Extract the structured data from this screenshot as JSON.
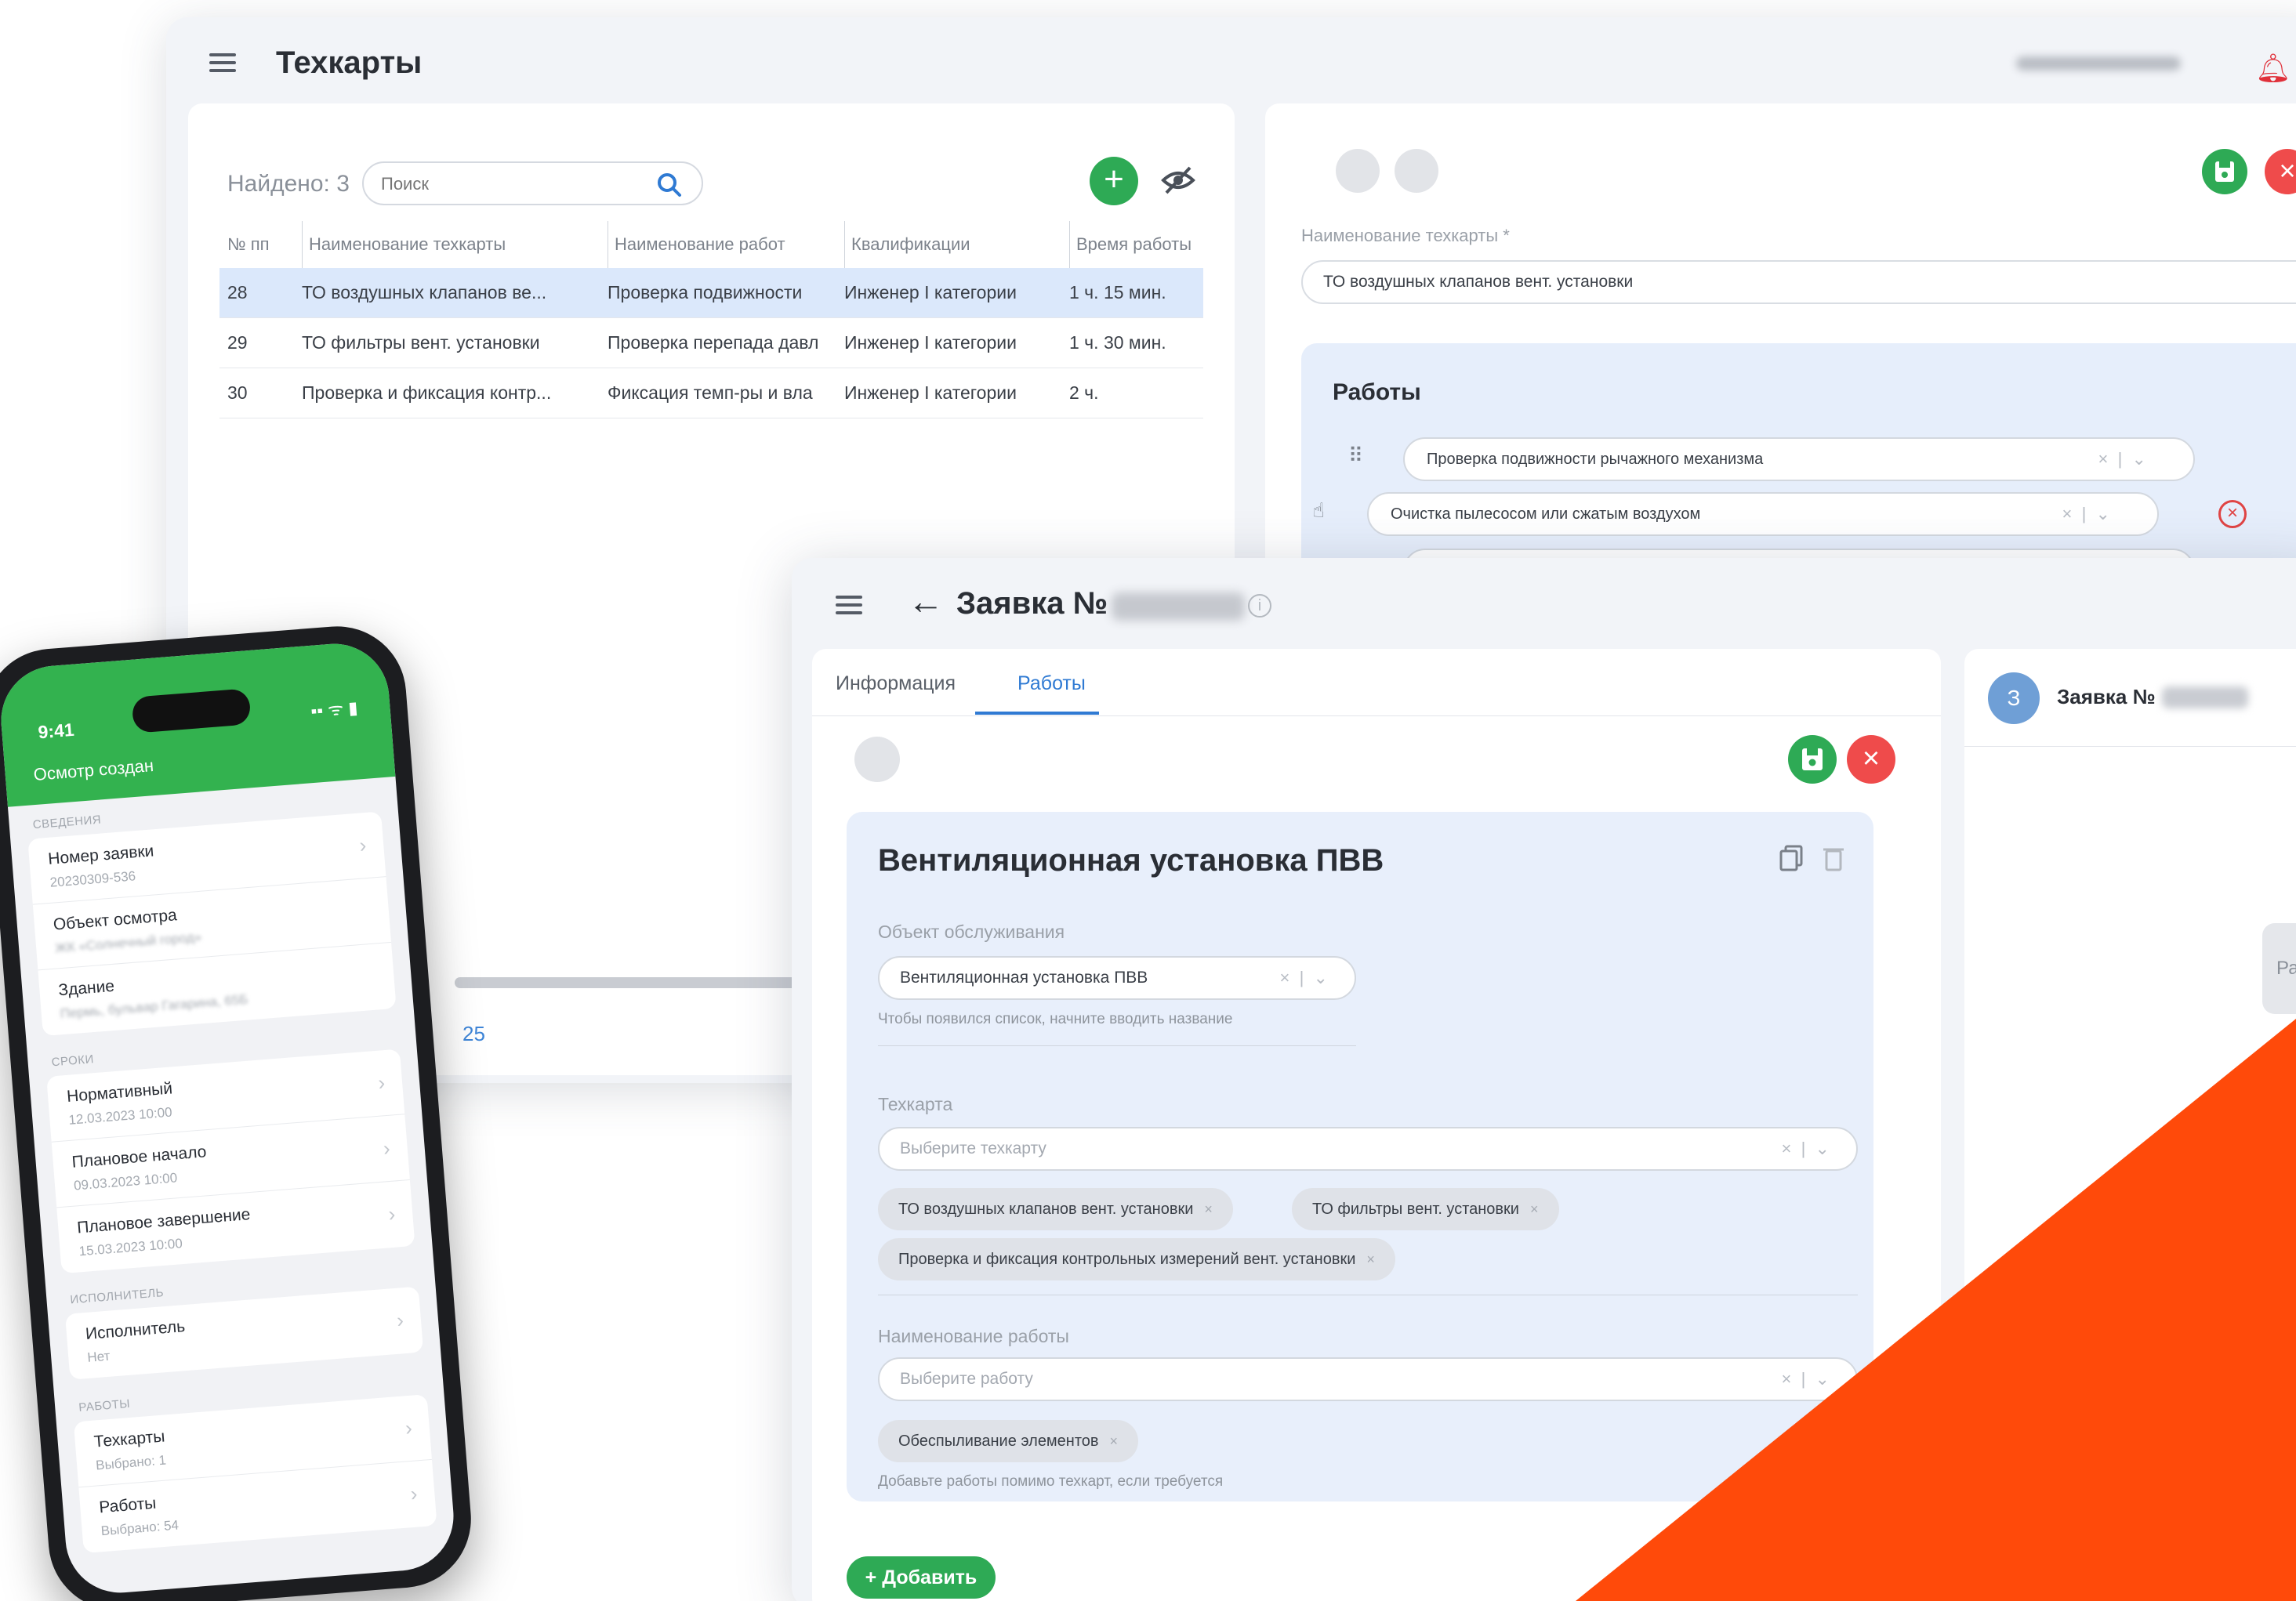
{
  "tech_window": {
    "title": "Техкарты",
    "found_label": "Найдено: 3",
    "search_placeholder": "Поиск",
    "table": {
      "headers": [
        "№ пп",
        "Наименование техкарты",
        "Наименование работ",
        "Квалификации",
        "Время работы"
      ],
      "rows": [
        {
          "num": "28",
          "name": "ТО воздушных клапанов ве...",
          "work": "Проверка подвижности",
          "qual": "Инженер I категории",
          "time": "1 ч. 15 мин."
        },
        {
          "num": "29",
          "name": "ТО фильтры вент. установки",
          "work": "Проверка перепада давл",
          "qual": "Инженер I категории",
          "time": "1 ч. 30 мин."
        },
        {
          "num": "30",
          "name": "Проверка и фиксация контр...",
          "work": "Фиксация темп-ры и вла",
          "qual": "Инженер I категории",
          "time": "2 ч."
        }
      ]
    },
    "pager_value": "25",
    "edit": {
      "name_label": "Наименование техкарты *",
      "name_value": "ТО воздушных клапанов вент. установки",
      "works_title": "Работы",
      "works": [
        "Проверка подвижности рычажного механизма",
        "Очистка пылесосом или сжатым воздухом"
      ]
    }
  },
  "order_window": {
    "title": "Заявка №",
    "tabs": [
      "Информация",
      "Работы"
    ],
    "equipment_title": "Вентиляционная установка ПВВ",
    "object_label": "Объект обслуживания",
    "object_value": "Вентиляционная установка ПВВ",
    "object_hint": "Чтобы появился список, начните вводить название",
    "techcard_label": "Техкарта",
    "techcard_placeholder": "Выберите техкарту",
    "techcard_chips": [
      "ТО воздушных клапанов вент. установки",
      "ТО фильтры вент. установки",
      "Проверка и фиксация контрольных измерений вент. установки"
    ],
    "work_label": "Наименование работы",
    "work_placeholder": "Выберите работу",
    "work_chips": [
      "Обеспыливание элементов"
    ],
    "work_hint": "Добавьте работы помимо техкарт, если требуется",
    "add_button": "+ Добавить",
    "side": {
      "avatar": "З",
      "title": "Заявка №",
      "pill_text": "Ра"
    }
  },
  "phone": {
    "time": "9:41",
    "status": "▪▪ ᯤ ▮",
    "header": "Осмотр создан",
    "sections": [
      {
        "label": "СВЕДЕНИЯ",
        "items": [
          {
            "title": "Номер заявки",
            "sub": "20230309-536"
          },
          {
            "title": "Объект осмотра",
            "sub": "ЖК «Солнечный город»"
          },
          {
            "title": "Здание",
            "sub": "Пермь, бульвар Гагарина, 65Б"
          }
        ]
      },
      {
        "label": "СРОКИ",
        "items": [
          {
            "title": "Нормативный",
            "sub": "12.03.2023 10:00"
          },
          {
            "title": "Плановое начало",
            "sub": "09.03.2023 10:00"
          },
          {
            "title": "Плановое завершение",
            "sub": "15.03.2023 10:00"
          }
        ]
      },
      {
        "label": "ИСПОЛНИТЕЛЬ",
        "items": [
          {
            "title": "Исполнитель",
            "sub": "Нет"
          }
        ]
      },
      {
        "label": "РАБОТЫ",
        "items": [
          {
            "title": "Техкарты",
            "sub": "Выбрано: 1"
          },
          {
            "title": "Работы",
            "sub": "Выбрано: 54"
          }
        ]
      }
    ]
  },
  "colors": {
    "accent_green": "#2eaa55",
    "danger_red": "#ef4b4b",
    "link_blue": "#2f7ad3",
    "decor_orange": "#ff4a0a",
    "phone_green": "#33b24f"
  }
}
